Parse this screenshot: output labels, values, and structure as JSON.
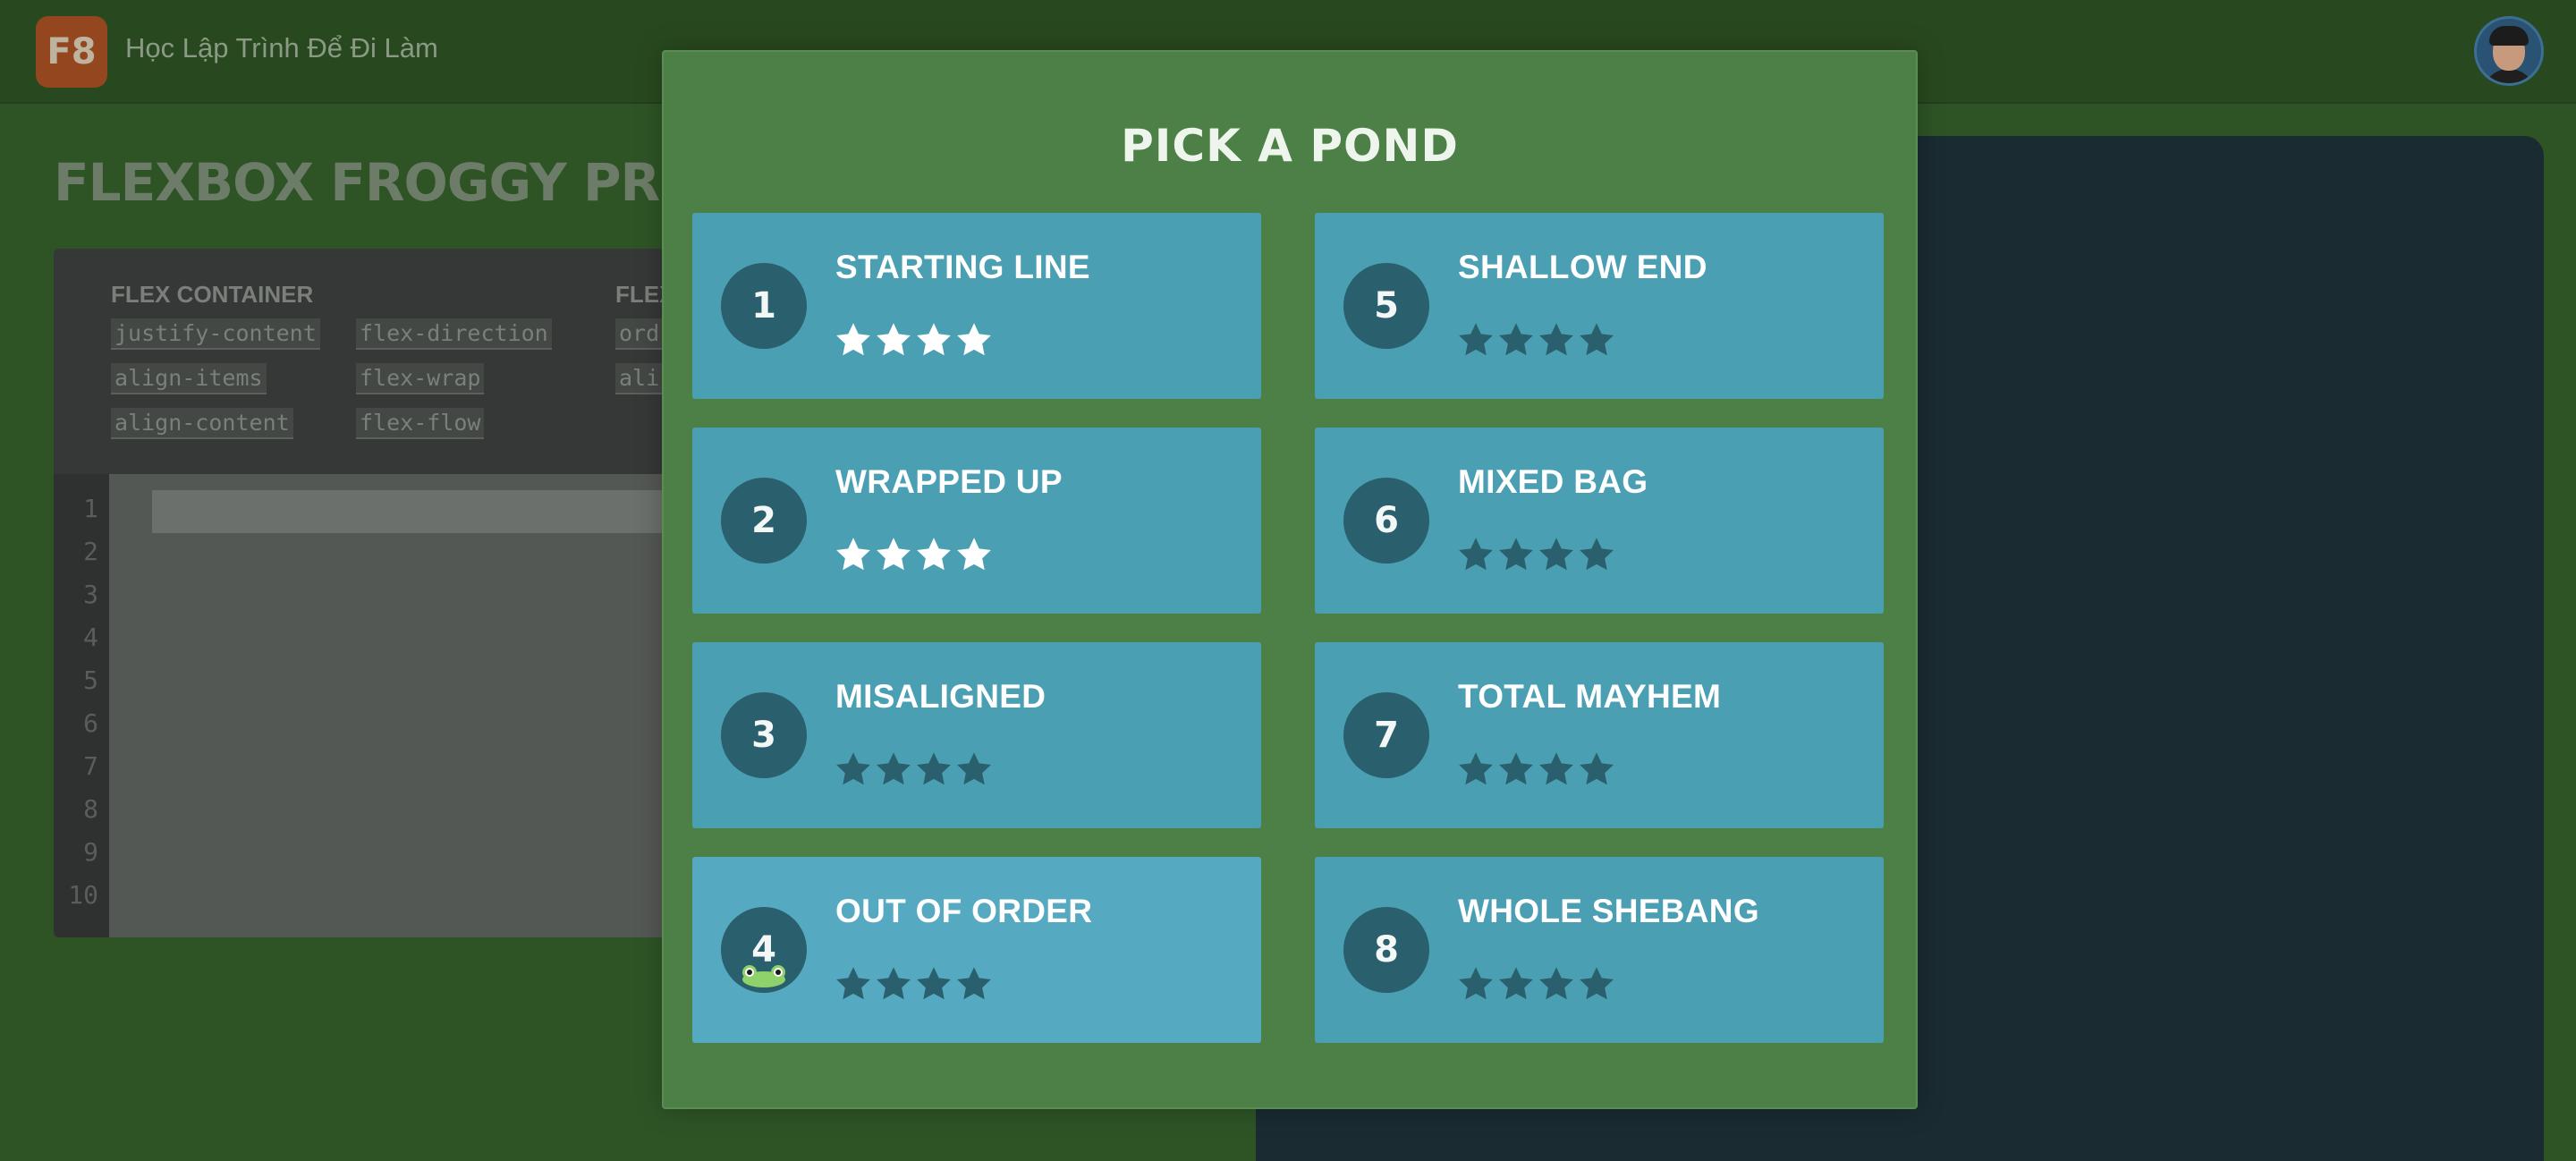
{
  "header": {
    "logo_text": "F8",
    "site_title": "Học Lập Trình Để Đi Làm"
  },
  "game": {
    "title": "FLEXBOX FROGGY PRO",
    "editor": {
      "container_heading": "FLEX CONTAINER",
      "container_props": [
        "justify-content",
        "flex-direction",
        "align-items",
        "flex-wrap",
        "align-content",
        "flex-flow"
      ],
      "item_heading": "FLEX",
      "item_props": [
        "ord",
        "ali"
      ],
      "line_numbers": [
        "1",
        "2",
        "3",
        "4",
        "5",
        "6",
        "7",
        "8",
        "9",
        "10"
      ]
    }
  },
  "modal": {
    "title": "PICK A POND",
    "levels": [
      {
        "number": "1",
        "name": "STARTING LINE",
        "stars_earned": 4,
        "stars_total": 4
      },
      {
        "number": "5",
        "name": "SHALLOW END",
        "stars_earned": 0,
        "stars_total": 4
      },
      {
        "number": "2",
        "name": "WRAPPED UP",
        "stars_earned": 4,
        "stars_total": 4
      },
      {
        "number": "6",
        "name": "MIXED BAG",
        "stars_earned": 0,
        "stars_total": 4
      },
      {
        "number": "3",
        "name": "MISALIGNED",
        "stars_earned": 0,
        "stars_total": 4
      },
      {
        "number": "7",
        "name": "TOTAL MAYHEM",
        "stars_earned": 0,
        "stars_total": 4
      },
      {
        "number": "4",
        "name": "OUT OF ORDER",
        "stars_earned": 0,
        "stars_total": 4,
        "current": true
      },
      {
        "number": "8",
        "name": "WHOLE SHEBANG",
        "stars_earned": 0,
        "stars_total": 4
      }
    ]
  },
  "colors": {
    "star_earned": "#ffffff",
    "star_empty": "#2a5f6d",
    "card": "#4b9fb3",
    "modal": "#4d8046"
  }
}
